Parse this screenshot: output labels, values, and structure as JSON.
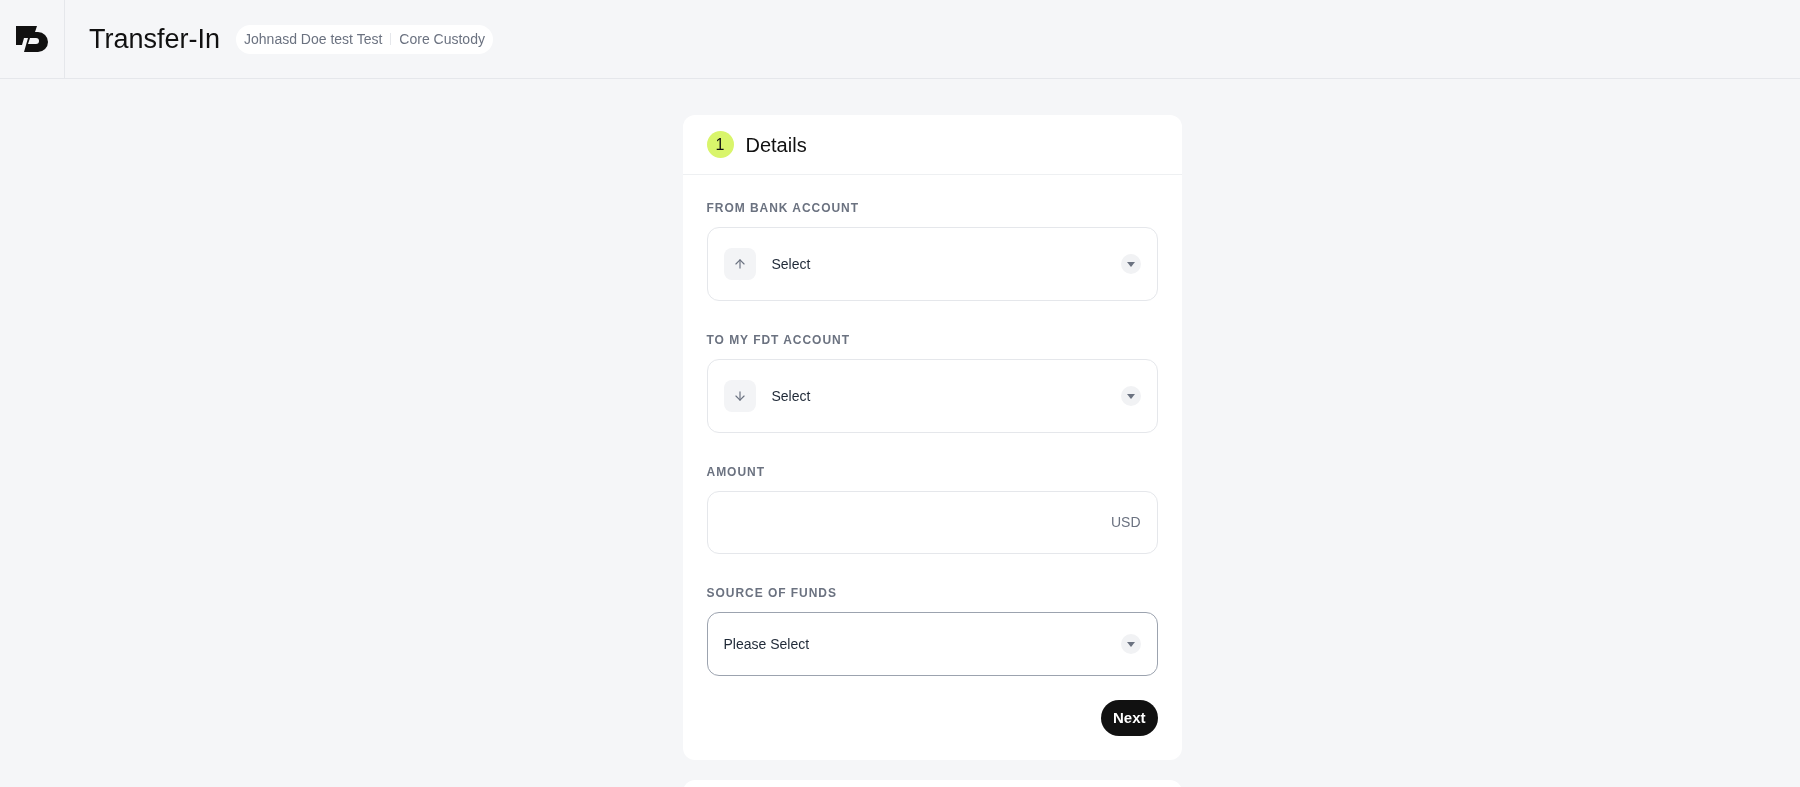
{
  "header": {
    "title": "Transfer-In",
    "breadcrumb": [
      "Johnasd Doe test Test",
      "Core Custody"
    ]
  },
  "step": {
    "number": "1",
    "title": "Details"
  },
  "fields": [
    {
      "kind": "outgoing_account",
      "label": "FROM BANK ACCOUNT",
      "placeholder": "Select",
      "focused": false
    },
    {
      "kind": "incoming_account",
      "label": "TO MY FDT ACCOUNT",
      "placeholder": "Select",
      "focused": false
    },
    {
      "kind": "amount",
      "label": "AMOUNT",
      "currency": "USD",
      "focused": false
    },
    {
      "kind": "select",
      "label": "SOURCE OF FUNDS",
      "placeholder": "Please Select",
      "focused": true
    }
  ],
  "next_button": "Next"
}
